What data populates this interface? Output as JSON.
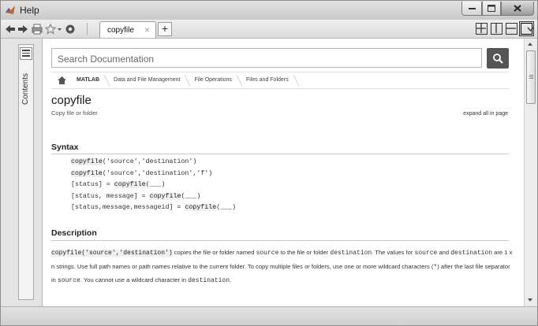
{
  "window": {
    "title": "Help"
  },
  "toolbar": {
    "tab_label": "copyfile",
    "tab_close": "×",
    "new_tab": "+"
  },
  "sidebar": {
    "contents_label": "Contents"
  },
  "search": {
    "placeholder": "Search Documentation"
  },
  "breadcrumbs": [
    "MATLAB",
    "Data and File Management",
    "File Operations",
    "Files and Folders"
  ],
  "page": {
    "title": "copyfile",
    "subtitle": "Copy file or folder",
    "expand_all": "expand all in page"
  },
  "syntax": {
    "heading": "Syntax",
    "lines": [
      {
        "pre": "",
        "fn": "copyfile",
        "post": "('source','destination')"
      },
      {
        "pre": "",
        "fn": "copyfile",
        "post": "('source','destination','f')"
      },
      {
        "pre": "[status] = ",
        "fn": "copyfile",
        "post": "(___)"
      },
      {
        "pre": "[status, message] = ",
        "fn": "copyfile",
        "post": "(___)"
      },
      {
        "pre": "[status,message,messageid] = ",
        "fn": "copyfile",
        "post": "(___)"
      }
    ]
  },
  "description": {
    "heading": "Description",
    "code_call": "copyfile('source','destination')",
    "t1": " copies the file or folder named ",
    "code_source": "source",
    "t2": " to the file or folder ",
    "code_dest": "destination",
    "t3": ". The values for ",
    "code_source2": "source",
    "t4": " and ",
    "code_dest2": "destination",
    "t5": " are 1 x n strings. Use full path names or path names relative to the current folder. To copy multiple files or folders, use one or more wildcard characters (",
    "code_star": "*",
    "t6": ") after the last file separator in ",
    "code_source3": "source",
    "t7": ". You cannot use a wildcard character in ",
    "code_dest3": "destination",
    "t8": "."
  },
  "icons": {
    "back": "back-arrow-icon",
    "forward": "forward-arrow-icon",
    "print": "print-icon",
    "favorites": "star-icon",
    "settings": "gear-icon",
    "search": "search-icon",
    "home": "home-icon"
  },
  "colors": {
    "search_button": "#555555",
    "code_highlight": "#efefef"
  }
}
